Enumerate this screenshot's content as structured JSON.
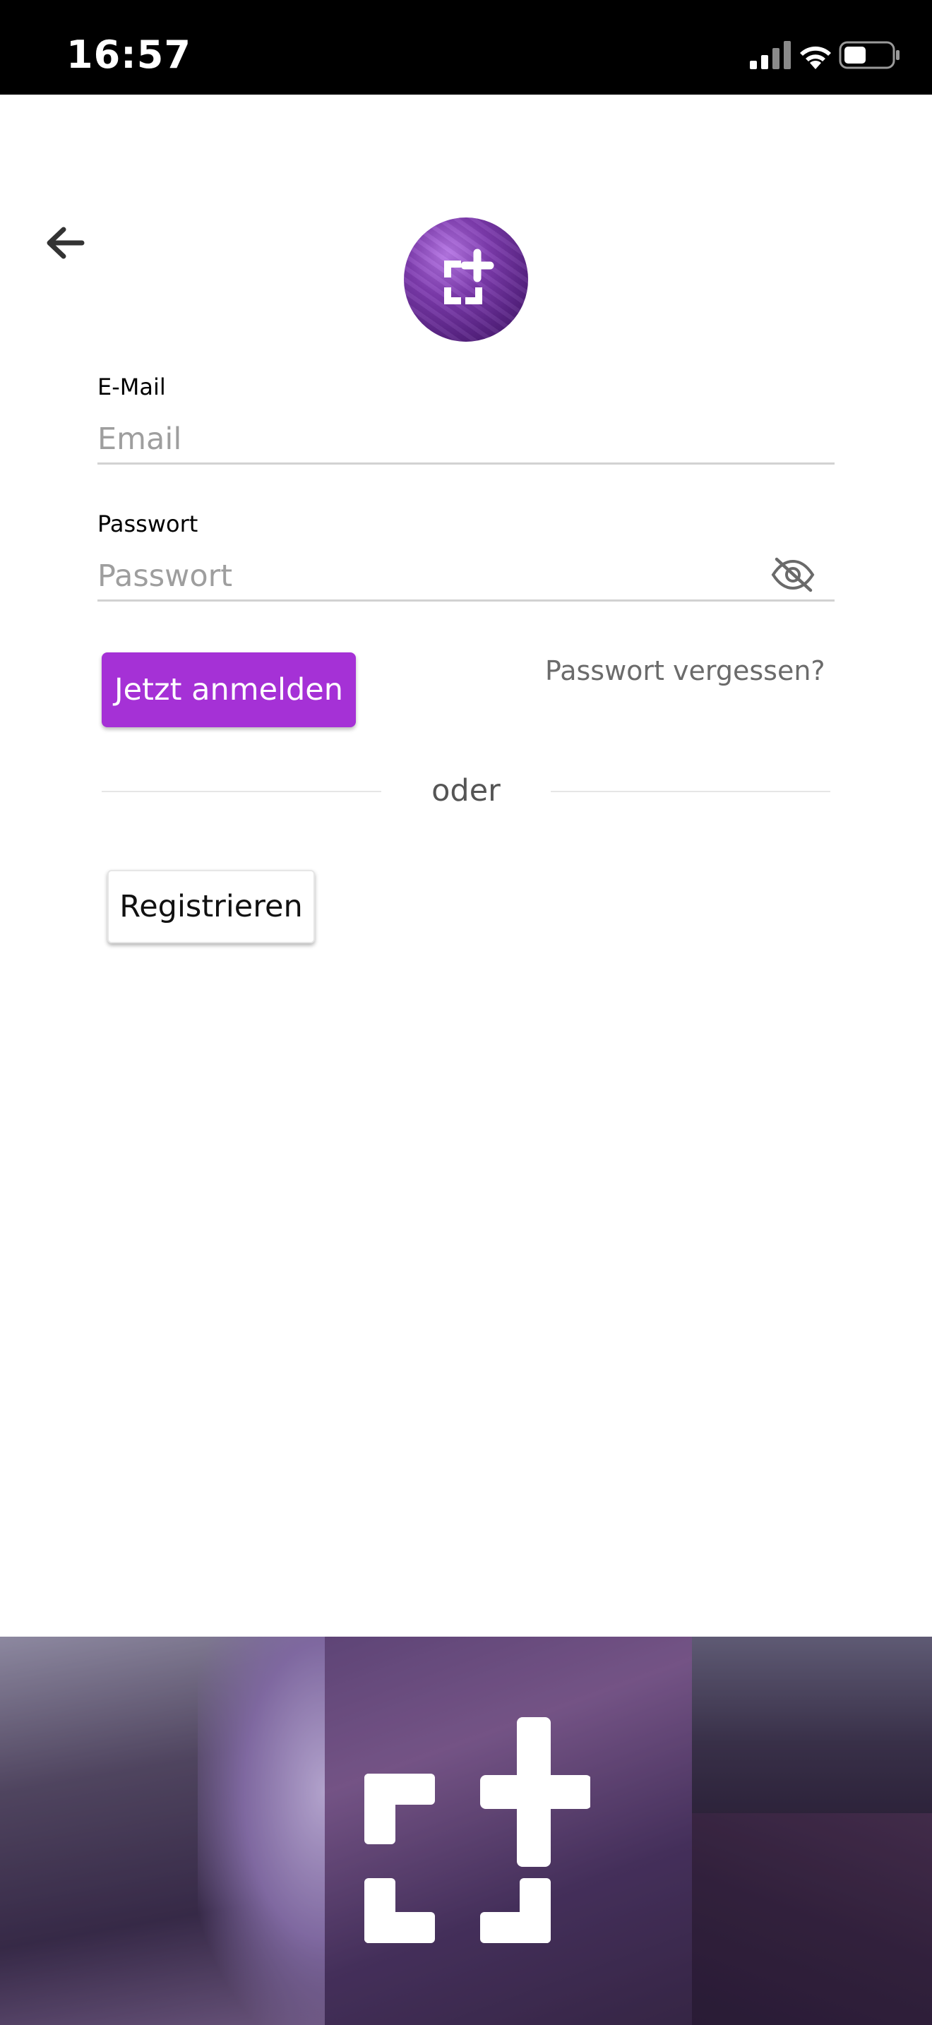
{
  "status_bar": {
    "time": "16:57",
    "signal_icon": "cellular-signal-icon",
    "wifi_icon": "wifi-icon",
    "battery_icon": "battery-icon"
  },
  "header": {
    "back_icon": "arrow-left-icon",
    "logo_icon": "app-logo-icon",
    "brand_color": "#7f3cb0"
  },
  "form": {
    "email": {
      "label": "E-Mail",
      "placeholder": "Email",
      "value": ""
    },
    "password": {
      "label": "Passwort",
      "placeholder": "Passwort",
      "value": "",
      "toggle_icon": "eye-off-icon"
    },
    "login_label": "Jetzt anmelden",
    "forgot_label": "Passwort vergessen?",
    "divider_label": "oder",
    "register_label": "Registrieren",
    "accent_color": "#a531d6"
  },
  "banner": {
    "mark_icon": "brand-plus-bracket-icon"
  }
}
